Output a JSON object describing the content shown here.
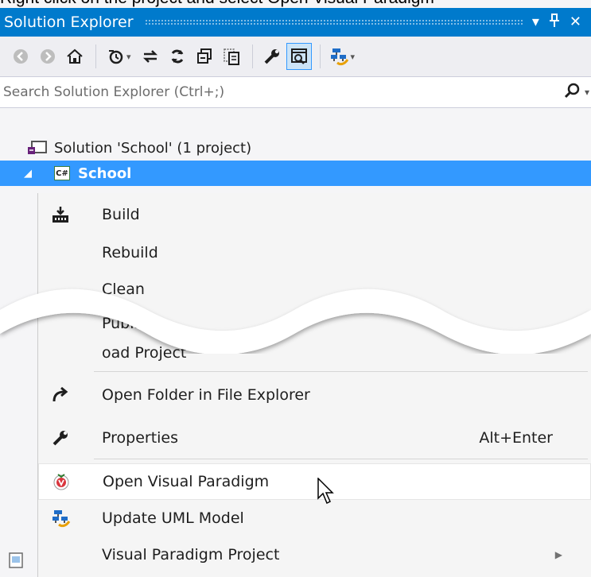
{
  "header_text": "Right click on the project and select Open Visual Paradigm",
  "panel": {
    "title": "Solution Explorer",
    "dropdown_glyph": "▾",
    "pin_glyph": "⊥",
    "close_glyph": "✕"
  },
  "toolbar": {
    "icons": [
      "back-icon",
      "forward-icon",
      "home-icon",
      "pending-changes-icon",
      "sync-icon",
      "refresh-icon",
      "collapse-all-icon",
      "show-all-files-icon",
      "properties-wrench-icon",
      "preview-selected-icon",
      "class-diagram-icon"
    ],
    "caret": "▾"
  },
  "search": {
    "placeholder": "Search Solution Explorer (Ctrl+;)",
    "icon": "search-icon",
    "caret": "▾"
  },
  "tree": {
    "solution_label": "Solution 'School' (1 project)",
    "project_label": "School",
    "project_badge": "C#",
    "expander": "◢"
  },
  "menu": {
    "items": [
      {
        "label": "Build",
        "icon": "build-icon",
        "shortcut": ""
      },
      {
        "label": "Rebuild",
        "icon": "",
        "shortcut": ""
      },
      {
        "label": "Clean",
        "icon": "",
        "shortcut": ""
      },
      {
        "label": "Publi",
        "icon": "",
        "shortcut": ""
      },
      {
        "label": "oad Project",
        "icon": "",
        "shortcut": ""
      },
      {
        "label": "Open Folder in File Explorer",
        "icon": "open-folder-arrow-icon",
        "shortcut": ""
      },
      {
        "label": "Properties",
        "icon": "wrench-icon",
        "shortcut": "Alt+Enter"
      },
      {
        "label": "Open Visual Paradigm",
        "icon": "visual-paradigm-icon",
        "shortcut": ""
      },
      {
        "label": "Update UML Model",
        "icon": "update-uml-icon",
        "shortcut": ""
      },
      {
        "label": "Visual Paradigm Project",
        "icon": "",
        "shortcut": "",
        "submenu_glyph": "▶"
      }
    ]
  },
  "colors": {
    "accent": "#007acc",
    "selection": "#3399ff",
    "menu_bg": "#f5f5f5"
  }
}
